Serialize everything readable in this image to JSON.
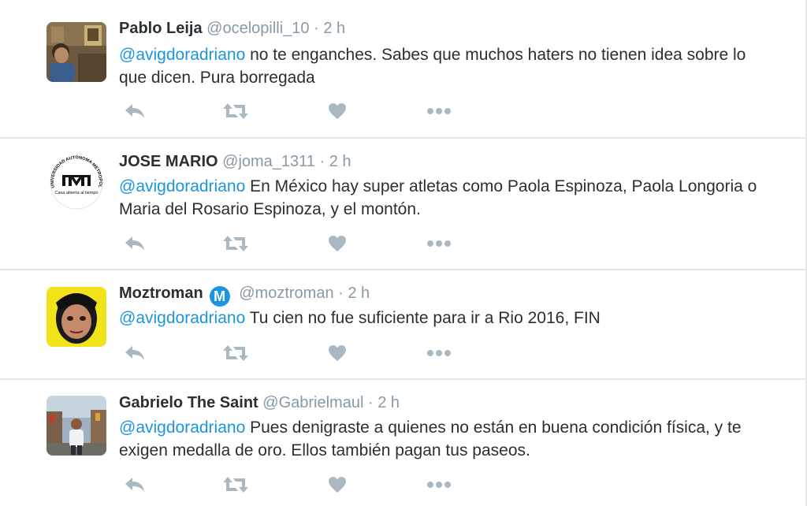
{
  "tweets": [
    {
      "name": "Pablo Leija",
      "handle": "@ocelopilli_10",
      "separator": "·",
      "time": "2 h",
      "mention": "@avigdoradriano",
      "text": " no te enganches. Sabes que muchos haters no tienen idea sobre lo que dicen. Pura borregada",
      "verified": false
    },
    {
      "name": "JOSE MARIO",
      "handle": "@joma_1311",
      "separator": "·",
      "time": "2 h",
      "mention": "@avigdoradriano",
      "text": " En México hay super atletas como Paola Espinoza, Paola Longoria o Maria del Rosario Espinoza, y el montón.",
      "verified": false,
      "avatar_logo": {
        "letters": "UAM",
        "ring_text": "UNIVERSIDAD AUTÓNOMA METROPOLITANA",
        "motto": "Casa abierta al tiempo"
      }
    },
    {
      "name": "Moztroman",
      "badge": "M",
      "handle": "@moztroman",
      "separator": "·",
      "time": "2 h",
      "mention": "@avigdoradriano",
      "text": " Tu cien no fue suficiente para ir a Rio 2016, FIN",
      "verified": true
    },
    {
      "name": "Gabrielo The Saint",
      "handle": "@Gabrielmaul",
      "separator": "·",
      "time": "2 h",
      "mention": "@avigdoradriano",
      "text": " Pues denigraste a quienes no están en buena condición física, y te exigen medalla de oro. Ellos también pagan tus paseos.",
      "verified": false
    }
  ],
  "icons": {
    "reply": "reply-icon",
    "retweet": "retweet-icon",
    "like": "heart-icon",
    "more": "more-icon"
  },
  "colors": {
    "mention": "#1b95e0",
    "action_icon": "#aab8c2",
    "meta": "#8899a6"
  }
}
